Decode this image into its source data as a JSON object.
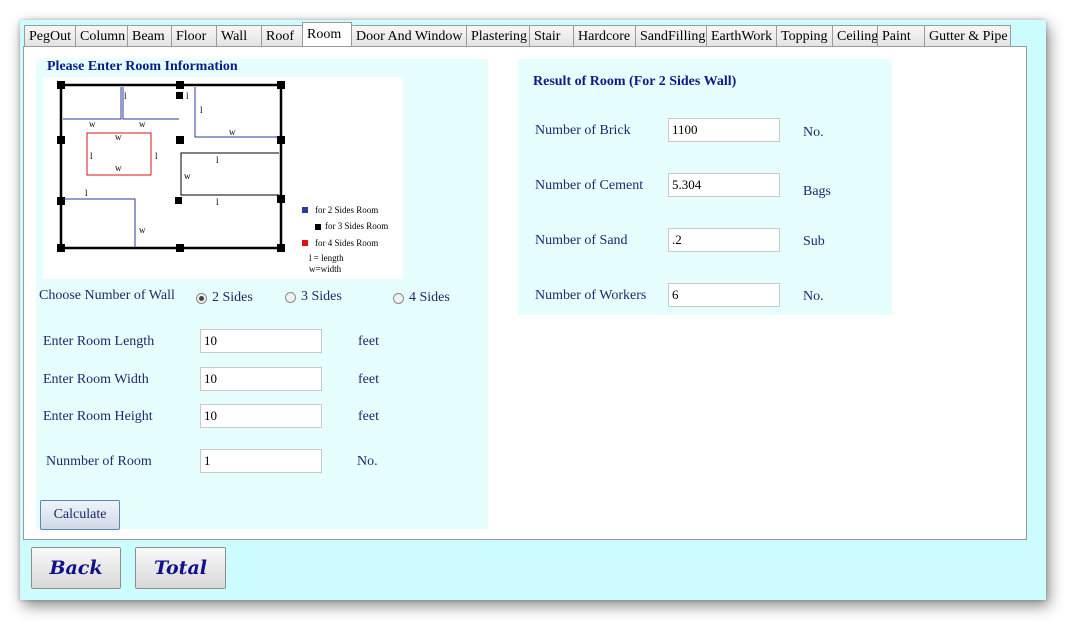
{
  "tabs": [
    "PegOut",
    "Column",
    "Beam",
    "Floor",
    "Wall",
    "Roof",
    "Room",
    "Door And Window",
    "Plastering",
    "Stair",
    "Hardcore",
    "SandFilling",
    "EarthWork",
    "Topping",
    "Ceiling",
    "Paint",
    "Gutter & Pipe"
  ],
  "active_tab": "Room",
  "input_panel": {
    "title": "Please Enter Room Information",
    "diagram": {
      "legend": [
        "for 2 Sides Room",
        "for 3 Sides Room",
        "for 4 Sides Room"
      ],
      "legend_colors": [
        "#2b3a9c",
        "#000000",
        "#e01010"
      ],
      "note_length": "l = length",
      "note_width": "w=width",
      "mark_l": "l",
      "mark_w": "w"
    },
    "wall_choice_label": "Choose Number of Wall",
    "wall_options": [
      "2 Sides",
      "3 Sides",
      "4 Sides"
    ],
    "wall_selected": "2 Sides",
    "length_label": "Enter Room Length",
    "length_value": "10",
    "length_unit": "feet",
    "width_label": "Enter Room Width",
    "width_value": "10",
    "width_unit": "feet",
    "height_label": "Enter Room Height",
    "height_value": "10",
    "height_unit": "feet",
    "rooms_label": "Nunmber of Room",
    "rooms_value": "1",
    "rooms_unit": "No.",
    "calculate_label": "Calculate"
  },
  "result_panel": {
    "title": "Result of Room (For 2 Sides Wall)",
    "brick_label": "Number of Brick",
    "brick_value": "1100",
    "brick_unit": "No.",
    "cement_label": "Number of Cement",
    "cement_value": "5.304",
    "cement_unit": "Bags",
    "sand_label": "Number of Sand",
    "sand_value": ".2",
    "sand_unit": "Sub",
    "workers_label": "Number of Workers",
    "workers_value": "6",
    "workers_unit": "No."
  },
  "footer": {
    "back_label": "Back",
    "total_label": "Total"
  }
}
